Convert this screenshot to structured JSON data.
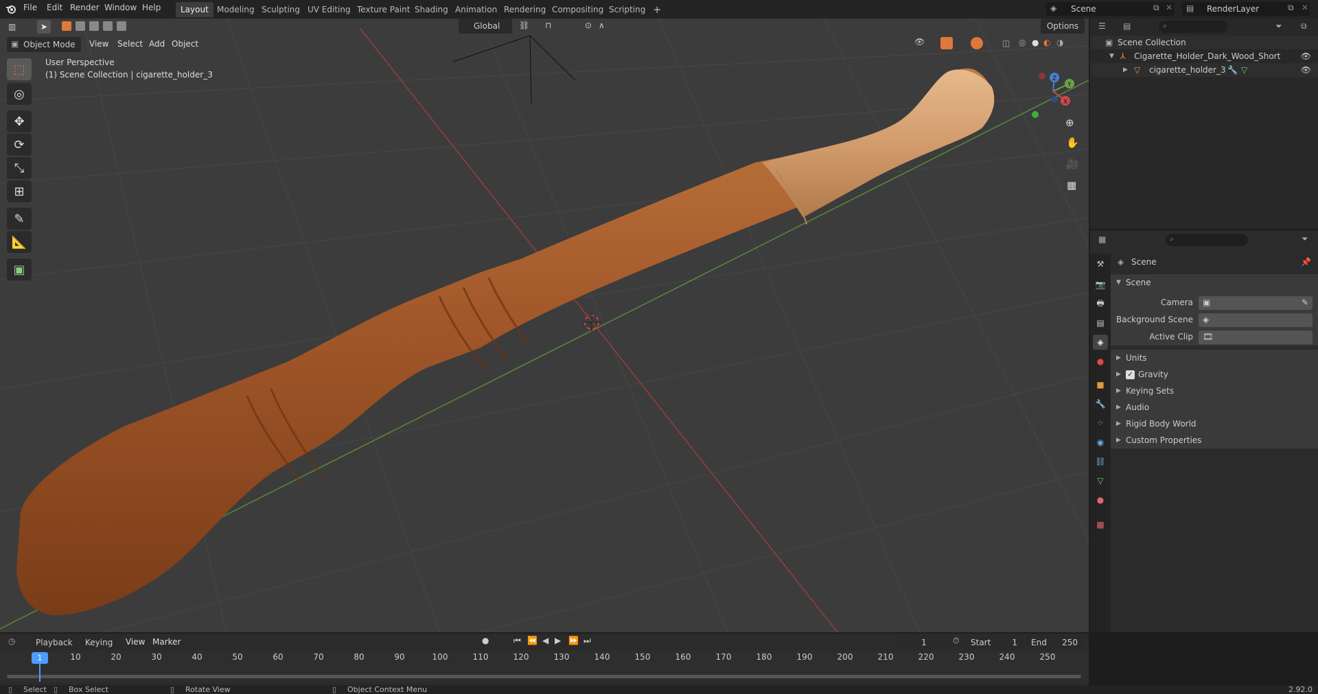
{
  "topbar": {
    "menus": [
      "File",
      "Edit",
      "Render",
      "Window",
      "Help"
    ],
    "workspaces": [
      "Layout",
      "Modeling",
      "Sculpting",
      "UV Editing",
      "Texture Paint",
      "Shading",
      "Animation",
      "Rendering",
      "Compositing",
      "Scripting"
    ],
    "active_workspace": "Layout",
    "add_tab": "+",
    "scene": "Scene",
    "view_layer": "RenderLayer"
  },
  "viewport": {
    "mode": "Object Mode",
    "menus": [
      "View",
      "Select",
      "Add",
      "Object"
    ],
    "orientation": "Global",
    "options": "Options",
    "perspective_label": "User Perspective",
    "collection_label": "(1) Scene Collection | cigarette_holder_3",
    "gizmo_axes": [
      "X",
      "Y",
      "Z"
    ]
  },
  "outliner": {
    "root": "Scene Collection",
    "collection": "Cigarette_Holder_Dark_Wood_Short",
    "object": "cigarette_holder_3"
  },
  "properties": {
    "context": "Scene",
    "panel_title": "Scene",
    "camera_label": "Camera",
    "background_scene_label": "Background Scene",
    "active_clip_label": "Active Clip",
    "sections": [
      "Units",
      "Gravity",
      "Keying Sets",
      "Audio",
      "Rigid Body World",
      "Custom Properties"
    ],
    "gravity_checked": true
  },
  "timeline": {
    "menus": [
      "Playback",
      "Keying",
      "View",
      "Marker"
    ],
    "current_frame": "1",
    "start_label": "Start",
    "start": "1",
    "end_label": "End",
    "end": "250",
    "ruler": [
      "10",
      "20",
      "30",
      "40",
      "50",
      "60",
      "70",
      "80",
      "90",
      "100",
      "110",
      "120",
      "130",
      "140",
      "150",
      "160",
      "170",
      "180",
      "190",
      "200",
      "210",
      "220",
      "230",
      "240",
      "250"
    ],
    "playhead_label": "1"
  },
  "statusbar": {
    "select": "Select",
    "box_select": "Box Select",
    "rotate_view": "Rotate View",
    "context_menu": "Object Context Menu",
    "version": "2.92.0"
  },
  "colors": {
    "accent": "#e0783c",
    "wood_dark": "#a3582a",
    "wood_light": "#d8a478"
  }
}
